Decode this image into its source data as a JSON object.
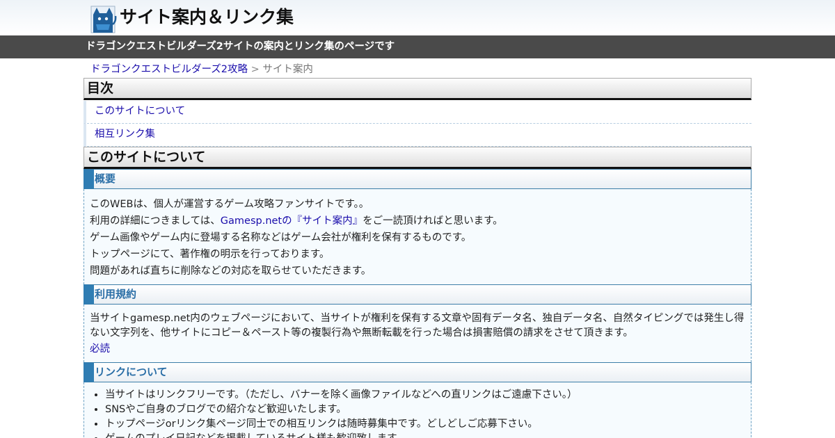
{
  "header": {
    "title": "サイト案内＆リンク集",
    "tagline": "ドラゴンクエストビルダーズ2サイトの案内とリンク集のページです"
  },
  "breadcrumb": {
    "parent": "ドラゴンクエストビルダーズ2攻略",
    "separator": ">",
    "current": "サイト案内"
  },
  "toc": {
    "heading": "目次",
    "items": [
      "このサイトについて",
      "相互リンク集"
    ]
  },
  "about": {
    "heading": "このサイトについて",
    "overview": {
      "heading": "概要",
      "line1": "このWEBは、個人が運営するゲーム攻略ファンサイトです。。",
      "line2_prefix": "利用の詳細につきましては、",
      "line2_link": "Gamesp.netの『サイト案内』",
      "line2_suffix": "をご一読頂ければと思います。",
      "line3": "ゲーム画像やゲーム内に登場する名称などはゲーム会社が権利を保有するものです。",
      "line4": "トップページにて、著作権の明示を行っております。",
      "line5": "問題があれば直ちに削除などの対応を取らせていただきます。"
    },
    "terms": {
      "heading": "利用規約",
      "text": "当サイトgamesp.net内のウェブページにおいて、当サイトが権利を保有する文章や固有データ名、独自データ名、自然タイピングでは発生し得ない文字列を、他サイトにコピー＆ペースト等の複製行為や無断転載を行った場合は損害賠償の請求をさせて頂きます。",
      "link": "必読"
    },
    "links": {
      "heading": "リンクについて",
      "items": [
        "当サイトはリンクフリーです。（ただし、バナーを除く画像ファイルなどへの直リンクはご遠慮下さい。）",
        "SNSやご自身のブログでの紹介など歓迎いたします。",
        "トップページorリンク集ページ同士での相互リンクは随時募集中です。どしどしご応募下さい。",
        "ゲームのプレイ日記などを掲載しているサイト様も歓迎致します。"
      ]
    }
  }
}
